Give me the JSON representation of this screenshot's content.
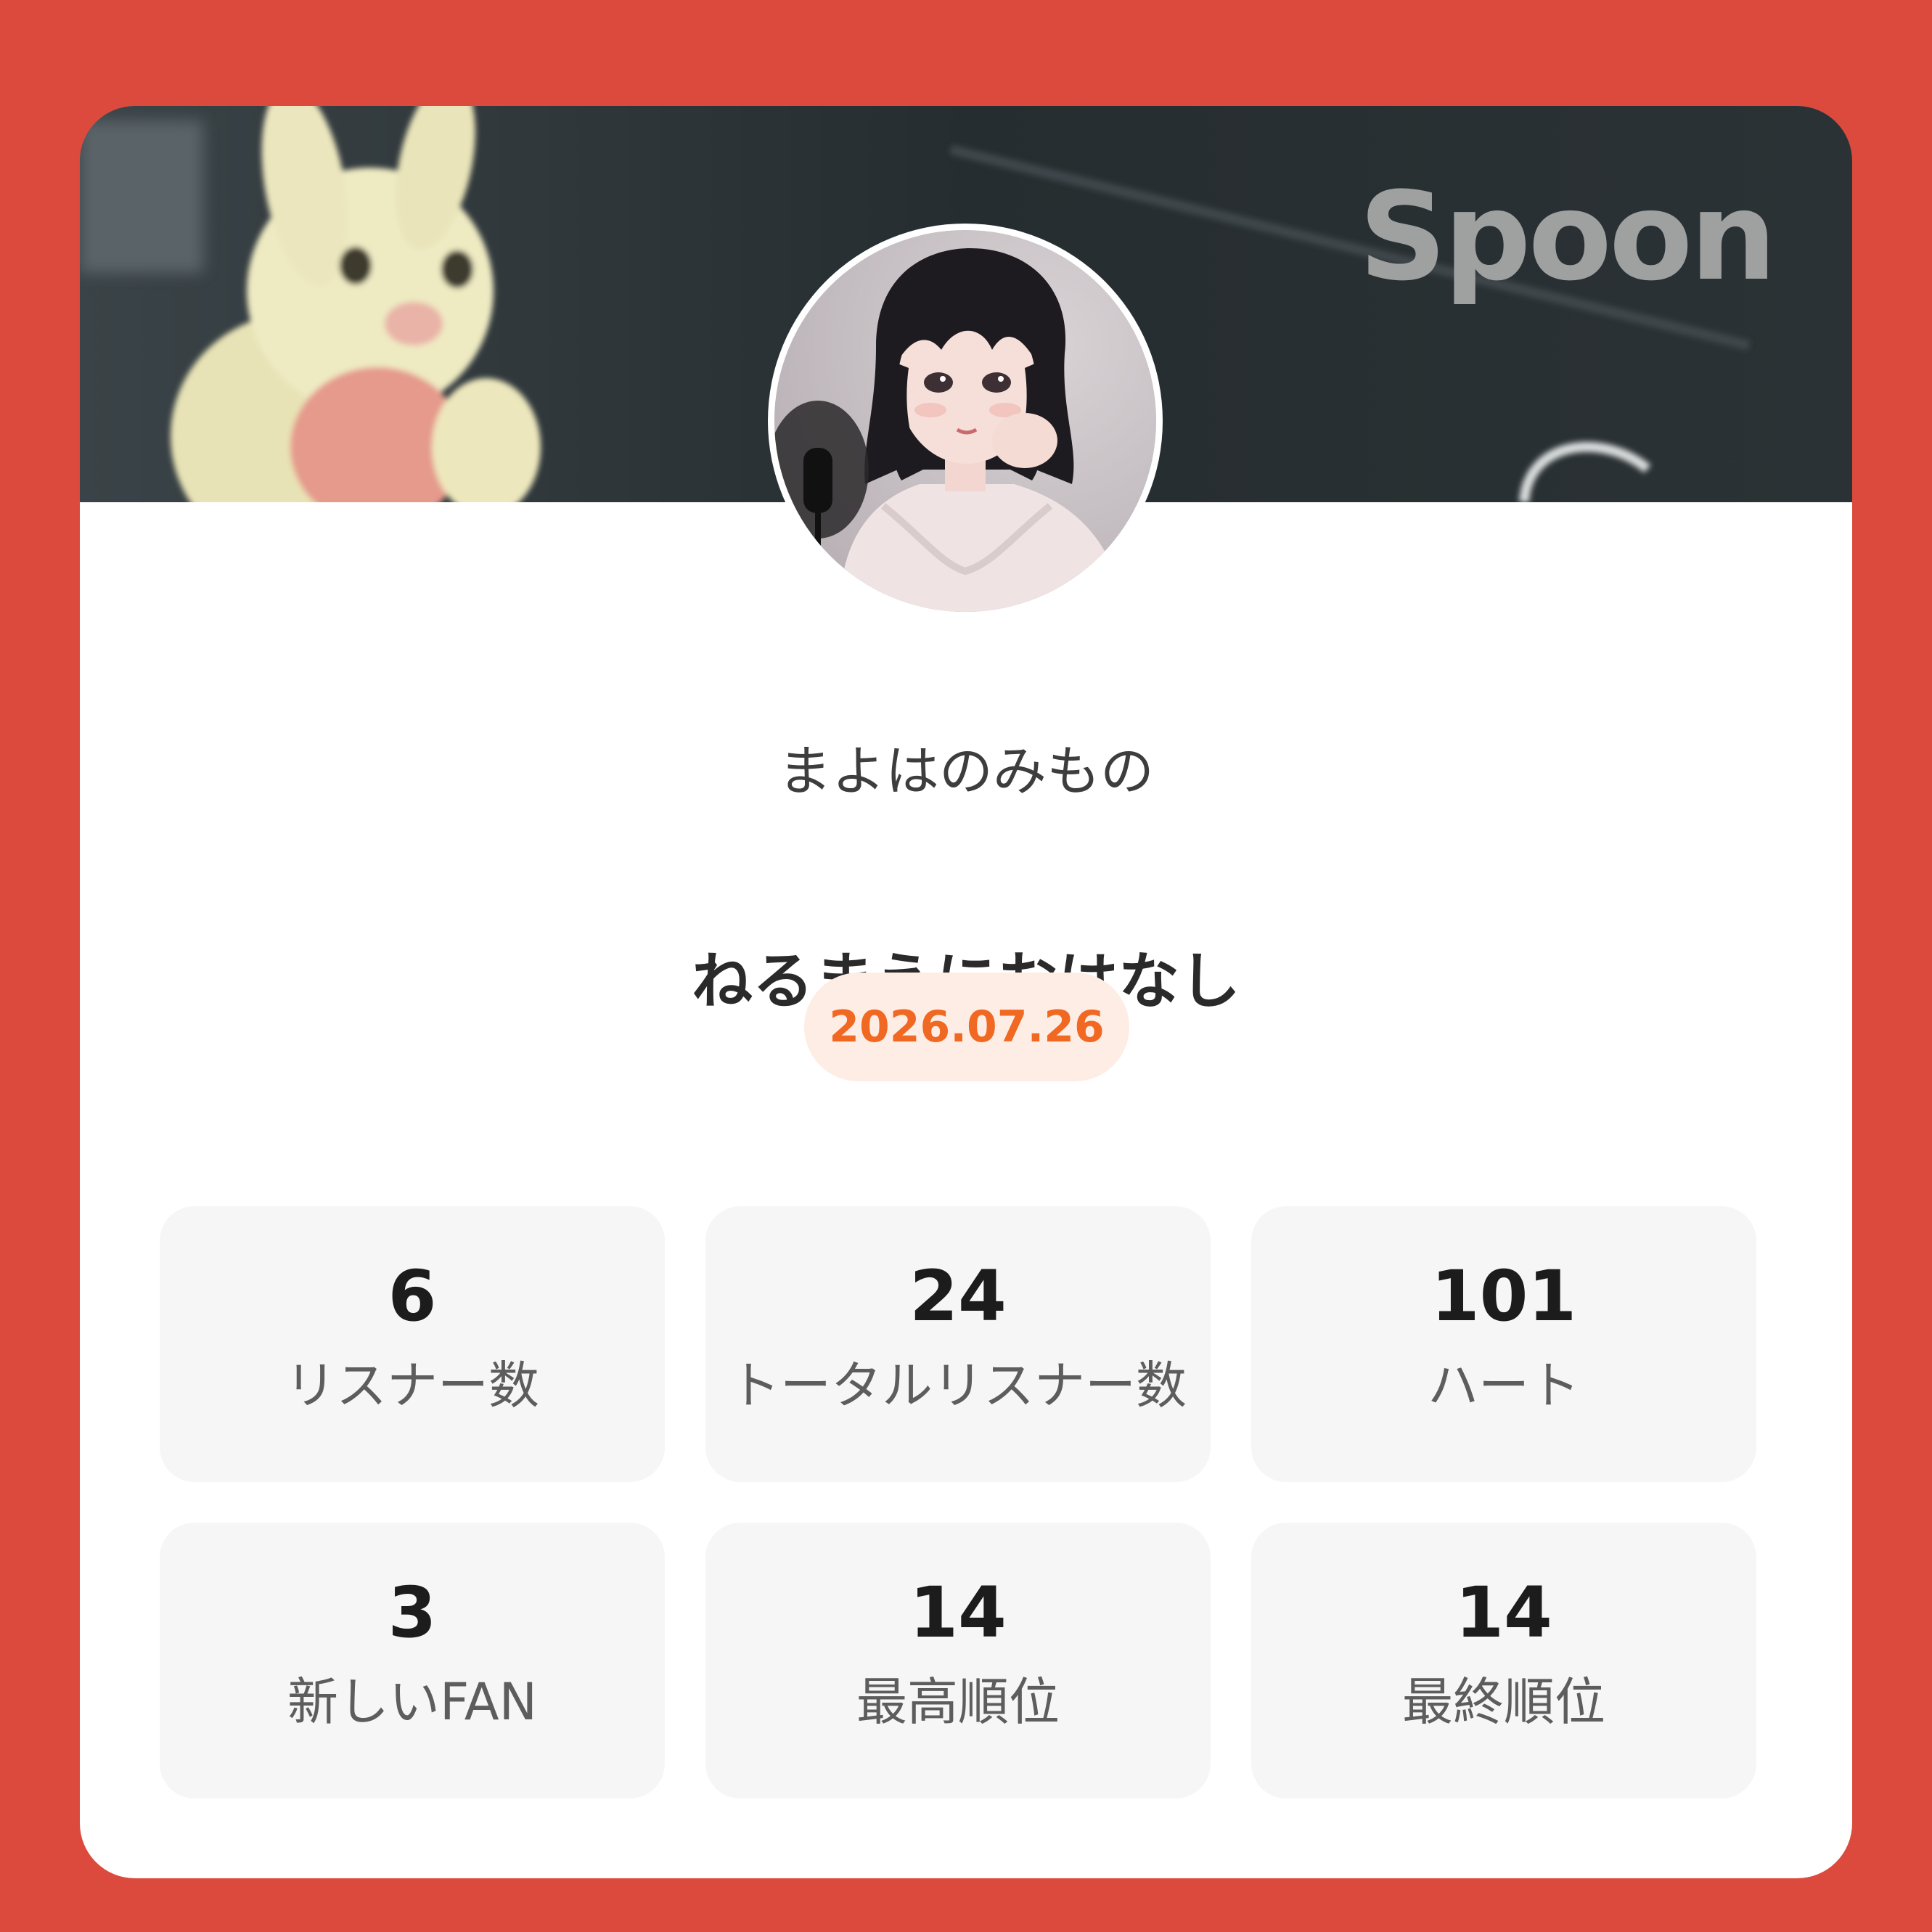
{
  "brand": "Spoon",
  "profile": {
    "username": "まよはのみもの"
  },
  "broadcast": {
    "title": "ねるまえにおはなし",
    "date": "2026.07.26"
  },
  "stats": [
    {
      "value": "6",
      "label": "リスナー数"
    },
    {
      "value": "24",
      "label": "トータルリスナー数"
    },
    {
      "value": "101",
      "label": "ハート"
    },
    {
      "value": "3",
      "label": "新しいFAN"
    },
    {
      "value": "14",
      "label": "最高順位"
    },
    {
      "value": "14",
      "label": "最終順位"
    }
  ],
  "colors": {
    "background": "#db4a3c",
    "card": "#ffffff",
    "accent": "#f06822",
    "badge_bg": "#feede5",
    "stat_bg": "#f6f6f6"
  }
}
